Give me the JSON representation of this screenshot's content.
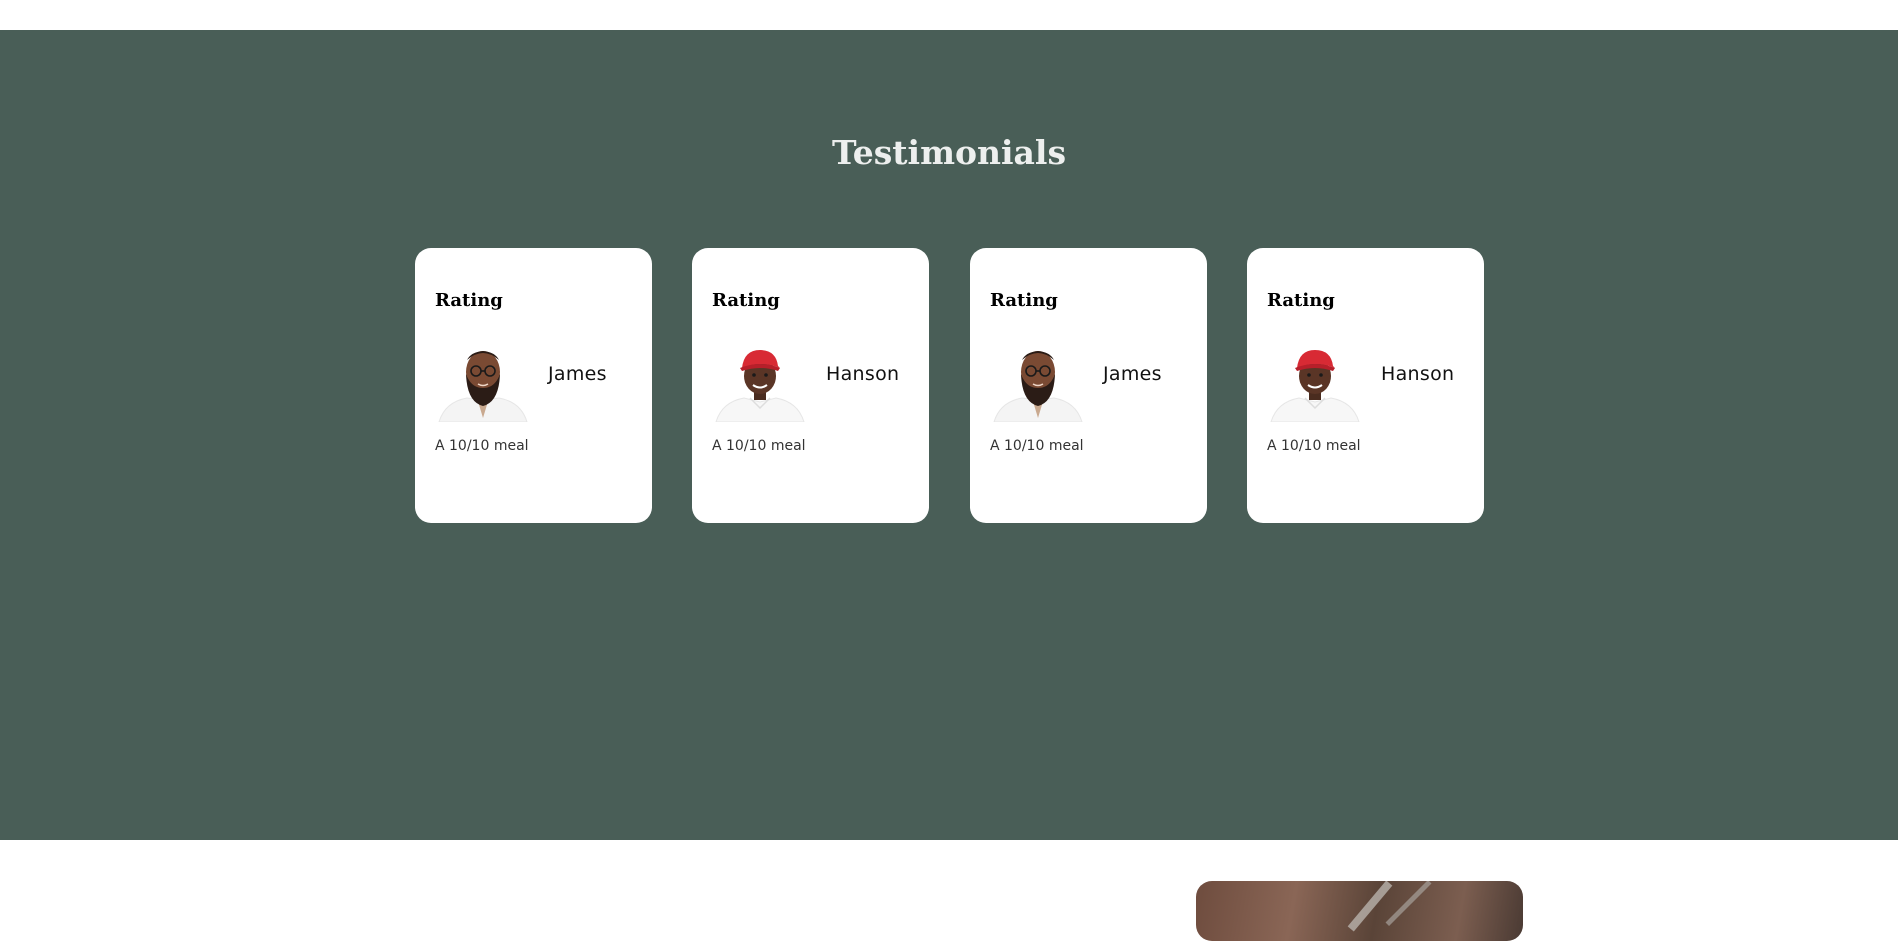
{
  "section": {
    "title": "Testimonials",
    "background_color": "#495e57"
  },
  "testimonials": [
    {
      "rating_label": "Rating",
      "name": "James",
      "review": "A 10/10 meal",
      "avatar_icon": "bearded-man-avatar"
    },
    {
      "rating_label": "Rating",
      "name": "Hanson",
      "review": "A 10/10 meal",
      "avatar_icon": "red-cap-man-avatar"
    },
    {
      "rating_label": "Rating",
      "name": "James",
      "review": "A 10/10 meal",
      "avatar_icon": "bearded-man-avatar"
    },
    {
      "rating_label": "Rating",
      "name": "Hanson",
      "review": "A 10/10 meal",
      "avatar_icon": "red-cap-man-avatar"
    }
  ]
}
